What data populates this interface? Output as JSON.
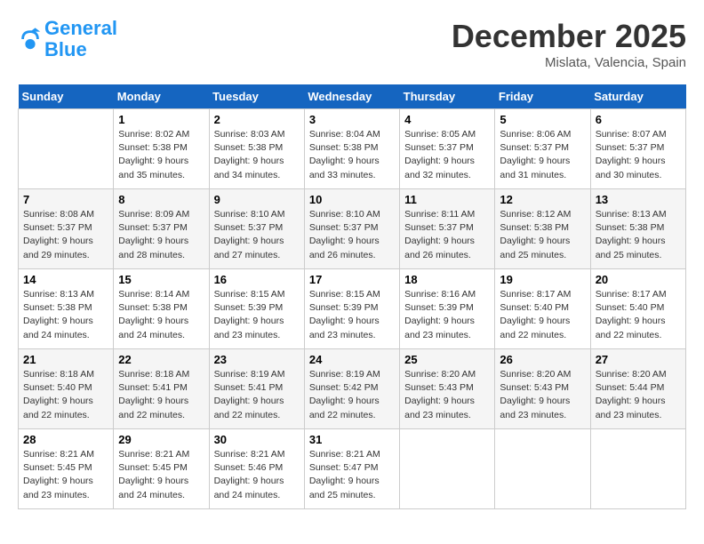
{
  "logo": {
    "line1": "General",
    "line2": "Blue"
  },
  "title": "December 2025",
  "subtitle": "Mislata, Valencia, Spain",
  "weekdays": [
    "Sunday",
    "Monday",
    "Tuesday",
    "Wednesday",
    "Thursday",
    "Friday",
    "Saturday"
  ],
  "weeks": [
    [
      {
        "day": "",
        "info": ""
      },
      {
        "day": "1",
        "info": "Sunrise: 8:02 AM\nSunset: 5:38 PM\nDaylight: 9 hours\nand 35 minutes."
      },
      {
        "day": "2",
        "info": "Sunrise: 8:03 AM\nSunset: 5:38 PM\nDaylight: 9 hours\nand 34 minutes."
      },
      {
        "day": "3",
        "info": "Sunrise: 8:04 AM\nSunset: 5:38 PM\nDaylight: 9 hours\nand 33 minutes."
      },
      {
        "day": "4",
        "info": "Sunrise: 8:05 AM\nSunset: 5:37 PM\nDaylight: 9 hours\nand 32 minutes."
      },
      {
        "day": "5",
        "info": "Sunrise: 8:06 AM\nSunset: 5:37 PM\nDaylight: 9 hours\nand 31 minutes."
      },
      {
        "day": "6",
        "info": "Sunrise: 8:07 AM\nSunset: 5:37 PM\nDaylight: 9 hours\nand 30 minutes."
      }
    ],
    [
      {
        "day": "7",
        "info": "Sunrise: 8:08 AM\nSunset: 5:37 PM\nDaylight: 9 hours\nand 29 minutes."
      },
      {
        "day": "8",
        "info": "Sunrise: 8:09 AM\nSunset: 5:37 PM\nDaylight: 9 hours\nand 28 minutes."
      },
      {
        "day": "9",
        "info": "Sunrise: 8:10 AM\nSunset: 5:37 PM\nDaylight: 9 hours\nand 27 minutes."
      },
      {
        "day": "10",
        "info": "Sunrise: 8:10 AM\nSunset: 5:37 PM\nDaylight: 9 hours\nand 26 minutes."
      },
      {
        "day": "11",
        "info": "Sunrise: 8:11 AM\nSunset: 5:37 PM\nDaylight: 9 hours\nand 26 minutes."
      },
      {
        "day": "12",
        "info": "Sunrise: 8:12 AM\nSunset: 5:38 PM\nDaylight: 9 hours\nand 25 minutes."
      },
      {
        "day": "13",
        "info": "Sunrise: 8:13 AM\nSunset: 5:38 PM\nDaylight: 9 hours\nand 25 minutes."
      }
    ],
    [
      {
        "day": "14",
        "info": "Sunrise: 8:13 AM\nSunset: 5:38 PM\nDaylight: 9 hours\nand 24 minutes."
      },
      {
        "day": "15",
        "info": "Sunrise: 8:14 AM\nSunset: 5:38 PM\nDaylight: 9 hours\nand 24 minutes."
      },
      {
        "day": "16",
        "info": "Sunrise: 8:15 AM\nSunset: 5:39 PM\nDaylight: 9 hours\nand 23 minutes."
      },
      {
        "day": "17",
        "info": "Sunrise: 8:15 AM\nSunset: 5:39 PM\nDaylight: 9 hours\nand 23 minutes."
      },
      {
        "day": "18",
        "info": "Sunrise: 8:16 AM\nSunset: 5:39 PM\nDaylight: 9 hours\nand 23 minutes."
      },
      {
        "day": "19",
        "info": "Sunrise: 8:17 AM\nSunset: 5:40 PM\nDaylight: 9 hours\nand 22 minutes."
      },
      {
        "day": "20",
        "info": "Sunrise: 8:17 AM\nSunset: 5:40 PM\nDaylight: 9 hours\nand 22 minutes."
      }
    ],
    [
      {
        "day": "21",
        "info": "Sunrise: 8:18 AM\nSunset: 5:40 PM\nDaylight: 9 hours\nand 22 minutes."
      },
      {
        "day": "22",
        "info": "Sunrise: 8:18 AM\nSunset: 5:41 PM\nDaylight: 9 hours\nand 22 minutes."
      },
      {
        "day": "23",
        "info": "Sunrise: 8:19 AM\nSunset: 5:41 PM\nDaylight: 9 hours\nand 22 minutes."
      },
      {
        "day": "24",
        "info": "Sunrise: 8:19 AM\nSunset: 5:42 PM\nDaylight: 9 hours\nand 22 minutes."
      },
      {
        "day": "25",
        "info": "Sunrise: 8:20 AM\nSunset: 5:43 PM\nDaylight: 9 hours\nand 23 minutes."
      },
      {
        "day": "26",
        "info": "Sunrise: 8:20 AM\nSunset: 5:43 PM\nDaylight: 9 hours\nand 23 minutes."
      },
      {
        "day": "27",
        "info": "Sunrise: 8:20 AM\nSunset: 5:44 PM\nDaylight: 9 hours\nand 23 minutes."
      }
    ],
    [
      {
        "day": "28",
        "info": "Sunrise: 8:21 AM\nSunset: 5:45 PM\nDaylight: 9 hours\nand 23 minutes."
      },
      {
        "day": "29",
        "info": "Sunrise: 8:21 AM\nSunset: 5:45 PM\nDaylight: 9 hours\nand 24 minutes."
      },
      {
        "day": "30",
        "info": "Sunrise: 8:21 AM\nSunset: 5:46 PM\nDaylight: 9 hours\nand 24 minutes."
      },
      {
        "day": "31",
        "info": "Sunrise: 8:21 AM\nSunset: 5:47 PM\nDaylight: 9 hours\nand 25 minutes."
      },
      {
        "day": "",
        "info": ""
      },
      {
        "day": "",
        "info": ""
      },
      {
        "day": "",
        "info": ""
      }
    ]
  ]
}
